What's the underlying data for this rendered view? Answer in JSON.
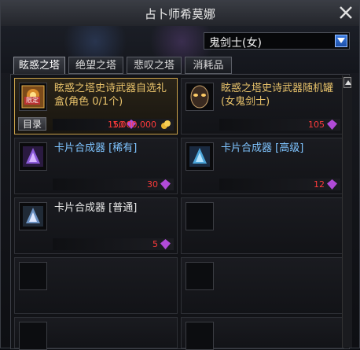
{
  "window": {
    "title": "占卜师希莫娜"
  },
  "character_select": {
    "value": "鬼剑士(女)"
  },
  "tabs": [
    {
      "label": "眩惑之塔"
    },
    {
      "label": "绝望之塔"
    },
    {
      "label": "悲叹之塔"
    },
    {
      "label": "消耗品"
    }
  ],
  "items": [
    {
      "name": "眩惑之塔史诗武器自选礼盒(角色 0/1个)",
      "price_gem": "150",
      "price_gold": "1,000,000",
      "badge": "限定",
      "catalog_label": "目录"
    },
    {
      "name": "眩惑之塔史诗武器随机罐(女鬼剑士)",
      "price_gem": "105"
    },
    {
      "name": "卡片合成器 [稀有]",
      "price_gem": "30"
    },
    {
      "name": "卡片合成器 [高级]",
      "price_gem": "12"
    },
    {
      "name": "卡片合成器 [普通]",
      "price_gem": "5"
    }
  ],
  "colors": {
    "gold_text": "#e9c36b",
    "blue_text": "#7fc4ff",
    "price_red": "#ff3b3b",
    "selected_border": "#c9a24a"
  }
}
